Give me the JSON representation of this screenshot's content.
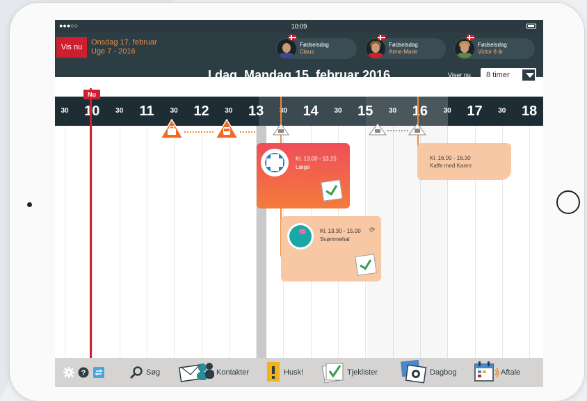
{
  "status_bar": {
    "signal": "●●●○○",
    "time": "10:09"
  },
  "header": {
    "vis_nu": "Vis nu",
    "current_date": "Onsdag 17. februar",
    "current_week": "Uge 7 - 2016",
    "birthdays": [
      {
        "label": "Fødselsdag",
        "name": "Claus"
      },
      {
        "label": "Fødselsdag",
        "name": "Anne-Marie"
      },
      {
        "label": "Fødselsdag",
        "name": "Victor 8 år"
      }
    ],
    "day_title": "I dag, Mandag 15. februar 2016",
    "viser_nu": "Viser nu",
    "timer_value": "8 timer"
  },
  "timeline": {
    "now_label": "Nu",
    "ticks": [
      "30",
      "10",
      "30",
      "11",
      "30",
      "12",
      "30",
      "13",
      "30",
      "14",
      "30",
      "15",
      "30",
      "16",
      "30",
      "17",
      "30",
      "18"
    ]
  },
  "events": [
    {
      "time": "Kl. 13.00 - 13.15",
      "name": "Læge",
      "icon": "medical-icon"
    },
    {
      "time": "Kl. 13.30 - 15.00",
      "name": "Svømmehal",
      "icon": "swimming-icon",
      "repeat_icon": "repeat-icon"
    },
    {
      "time": "Kl. 16.00 - 16.30",
      "name": "Kaffe med Karen"
    }
  ],
  "bottom_bar": {
    "search": "Søg",
    "contacts": "Kontakter",
    "remember": "Husk!",
    "checklists": "Tjeklister",
    "diary": "Dagbog",
    "appointment": "Aftale"
  },
  "colors": {
    "dark": "#2d3d44",
    "accent_red": "#cf1f2e",
    "accent_orange": "#f08a3c",
    "event_peach": "#f8c8a4"
  }
}
